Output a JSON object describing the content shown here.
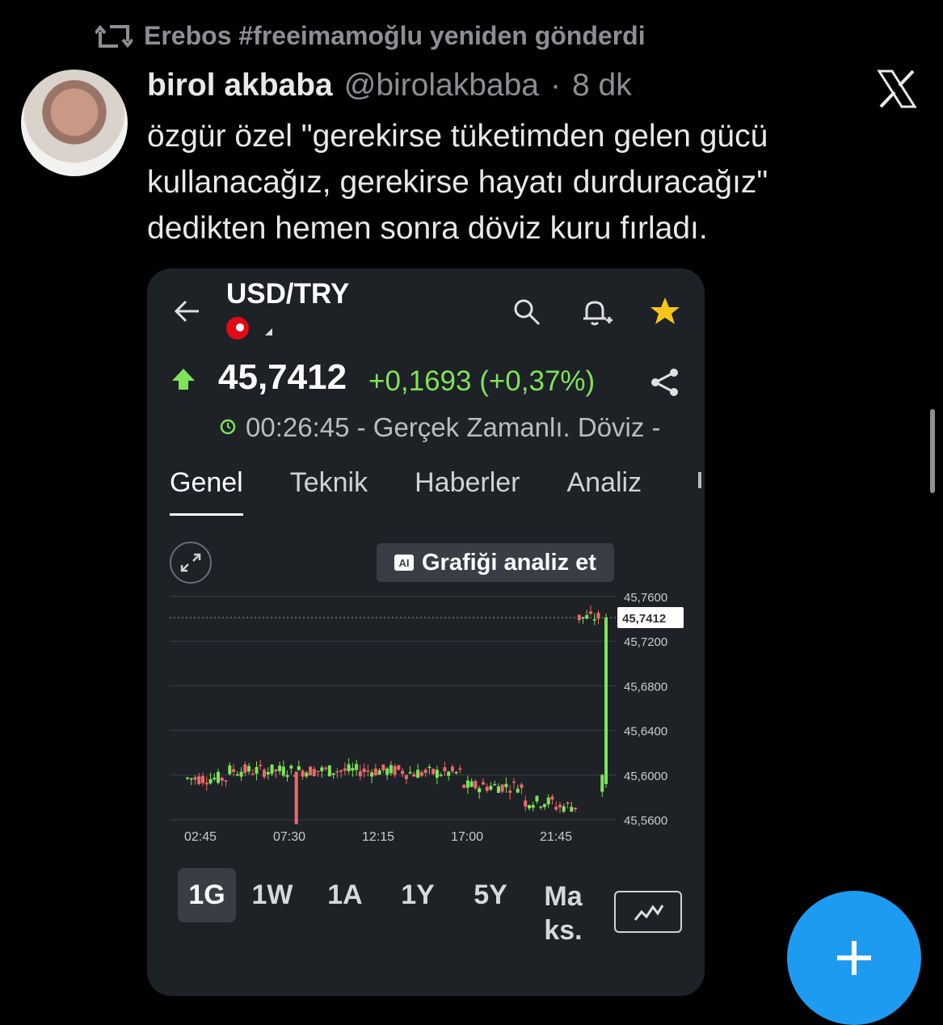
{
  "repost": {
    "text": "Erebos #freeimamoğlu yeniden gönderdi"
  },
  "tweet": {
    "author_name": "birol akbaba",
    "handle": "@birolakbaba",
    "separator": "·",
    "time": "8 dk",
    "lines": [
      "özgür özel \"gerekirse tüketimden gelen gücü",
      "kullanacağız, gerekirse hayatı durduracağız\"",
      "dedikten hemen sonra döviz kuru fırladı."
    ]
  },
  "card": {
    "pair": "USD/TRY",
    "price": "45,7412",
    "change": "+0,1693 (+0,37%)",
    "realtime": "00:26:45 - Gerçek Zamanlı. Döviz -",
    "tabs": [
      "Genel",
      "Teknik",
      "Haberler",
      "Analiz"
    ],
    "analyze_label": "Grafiği analiz et",
    "ai_badge": "AI",
    "periods": [
      "1G",
      "1W",
      "1A",
      "1Y",
      "5Y",
      "Ma\nks."
    ],
    "colors": {
      "up": "#7fe35a",
      "down": "#f0686a",
      "accent": "#f5c518",
      "fab": "#1d9bf0"
    }
  },
  "chart_data": {
    "type": "candlestick",
    "x_ticks": [
      "02:45",
      "07:30",
      "12:15",
      "17:00",
      "21:45"
    ],
    "y_ticks": [
      "45,7600",
      "45,7200",
      "45,6800",
      "45,6400",
      "45,6000",
      "45,5600"
    ],
    "ylim": [
      45.56,
      45.76
    ],
    "current_label": "45,7412",
    "current_value": 45.7412,
    "segments": [
      {
        "from": 0.0,
        "to": 0.1,
        "level": 45.597
      },
      {
        "from": 0.1,
        "to": 0.52,
        "level": 45.604
      },
      {
        "from": 0.52,
        "to": 0.66,
        "level": 45.602
      },
      {
        "from": 0.66,
        "to": 0.8,
        "level": 45.59
      },
      {
        "from": 0.8,
        "to": 0.88,
        "level": 45.576
      },
      {
        "from": 0.88,
        "to": 0.93,
        "level": 45.572
      },
      {
        "from": 0.93,
        "to": 1.0,
        "level": 45.741
      }
    ]
  }
}
